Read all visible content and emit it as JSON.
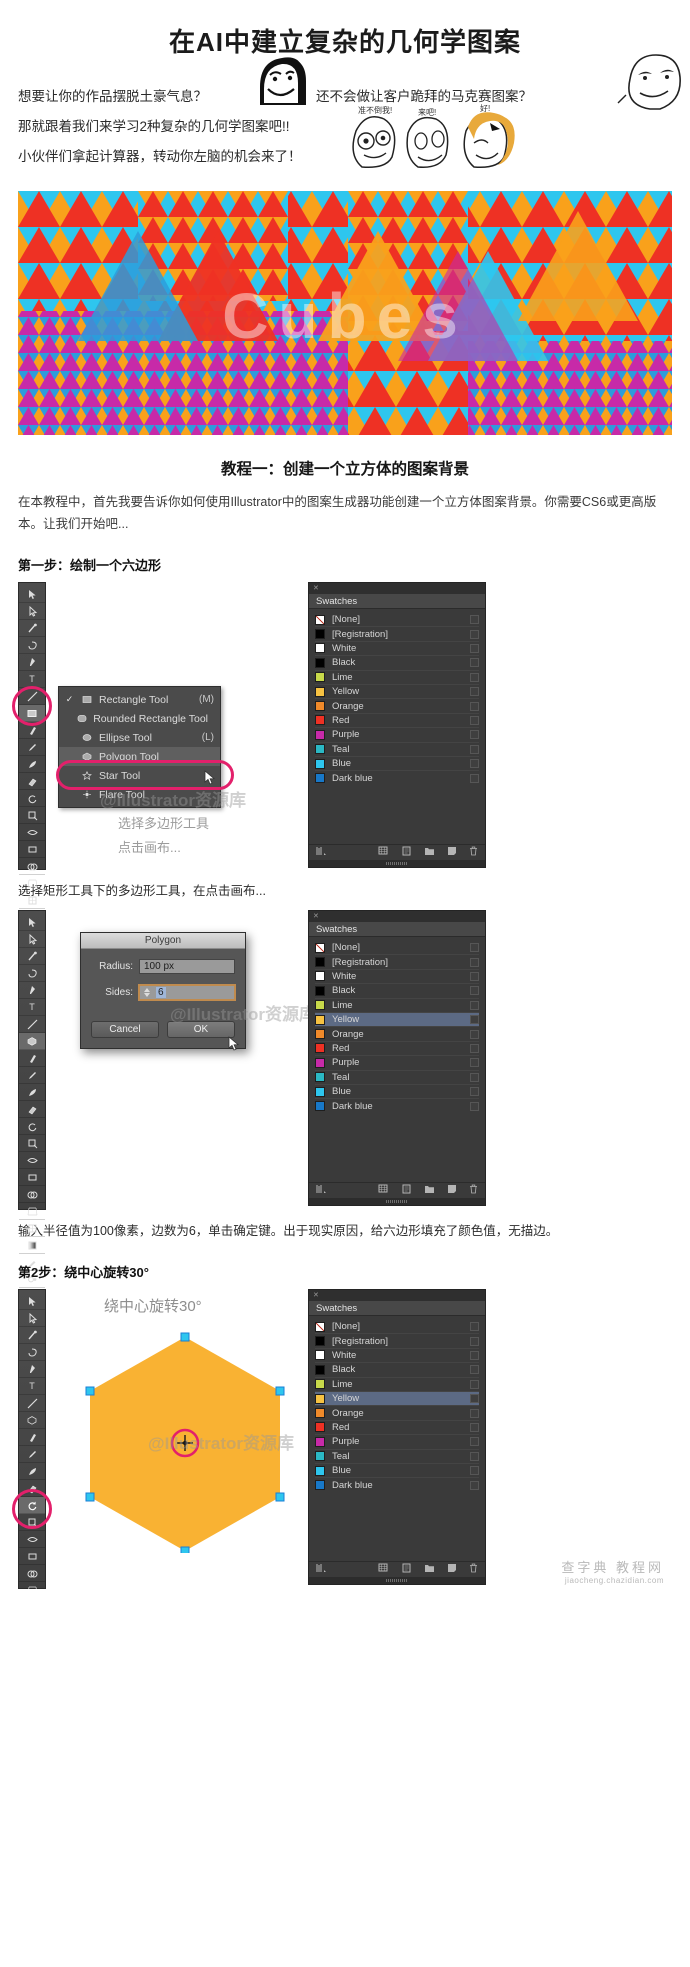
{
  "page": {
    "title": "在AI中建立复杂的几何学图案",
    "intro_lines": [
      "想要让你的作品摆脱土豪气息？",
      "还不会做让客户跪拜的马克赛图案？",
      "那就跟着我们来学习2种复杂的几何学图案吧!!",
      "小伙伴们拿起计算器，转动你左脑的机会来了！"
    ],
    "meme_labels": [
      "准不倒我!",
      "来吧!",
      "好!"
    ],
    "hero_word": "Cubes"
  },
  "tutorial": {
    "section_title": "教程一：创建一个立方体的图案背景",
    "intro_paragraph": "在本教程中，首先我要告诉你如何使用Illustrator中的图案生成器功能创建一个立方体图案背景。你需要CS6或更高版本。让我们开始吧...",
    "step1_title": "第一步：绘制一个六边形",
    "step1_caption": "选择矩形工具下的多边形工具，在点击画布...",
    "step1_annotation": [
      "选择多边形工具",
      "点击画布..."
    ],
    "step2_caption": "输入半径值为100像素，边数为6，单击确定键。出于现实原因，给六边形填充了颜色值，无描边。",
    "step2_title": "第2步：绕中心旋转30°",
    "step2_annotation": "绕中心旋转30°"
  },
  "tool_menu": {
    "items": [
      {
        "label": "Rectangle Tool",
        "shortcut": "(M)",
        "checked": true,
        "highlighted": false,
        "icon": "rectangle-icon"
      },
      {
        "label": "Rounded Rectangle Tool",
        "shortcut": "",
        "checked": false,
        "highlighted": false,
        "icon": "rounded-rectangle-icon"
      },
      {
        "label": "Ellipse Tool",
        "shortcut": "(L)",
        "checked": false,
        "highlighted": false,
        "icon": "ellipse-icon"
      },
      {
        "label": "Polygon Tool",
        "shortcut": "",
        "checked": false,
        "highlighted": true,
        "icon": "polygon-icon"
      },
      {
        "label": "Star Tool",
        "shortcut": "",
        "checked": false,
        "highlighted": false,
        "icon": "star-icon"
      },
      {
        "label": "Flare Tool",
        "shortcut": "",
        "checked": false,
        "highlighted": false,
        "icon": "flare-icon"
      }
    ]
  },
  "swatches_panel": {
    "tab_label": "Swatches",
    "rows": [
      {
        "name": "[None]",
        "color": "#ffffff",
        "kind": "none"
      },
      {
        "name": "[Registration]",
        "color": "#000000",
        "kind": "registration"
      },
      {
        "name": "White",
        "color": "#ffffff",
        "kind": "process"
      },
      {
        "name": "Black",
        "color": "#000000",
        "kind": "process"
      },
      {
        "name": "Lime",
        "color": "#c8d94a",
        "kind": "process"
      },
      {
        "name": "Yellow",
        "color": "#f7c242",
        "kind": "process"
      },
      {
        "name": "Orange",
        "color": "#f08a2a",
        "kind": "process"
      },
      {
        "name": "Red",
        "color": "#ee3124",
        "kind": "process"
      },
      {
        "name": "Purple",
        "color": "#c72aa8",
        "kind": "process"
      },
      {
        "name": "Teal",
        "color": "#2bb8c4",
        "kind": "process"
      },
      {
        "name": "Blue",
        "color": "#2ec6ee",
        "kind": "process"
      },
      {
        "name": "Dark blue",
        "color": "#1878c8",
        "kind": "process"
      }
    ],
    "selected_row": "Yellow"
  },
  "polygon_dialog": {
    "title": "Polygon",
    "radius_label": "Radius:",
    "radius_value": "100 px",
    "sides_label": "Sides:",
    "sides_value": "6",
    "cancel_label": "Cancel",
    "ok_label": "OK"
  },
  "watermarks": {
    "illustrator": "@Illustrator资源库",
    "footer_cn": "查字典 教程网",
    "footer_en": "jiaocheng.chazidian.com"
  },
  "colors": {
    "accent_pink": "#e3206b",
    "hexagon_fill": "#F9B233",
    "panel_bg": "#3a3a3a"
  }
}
